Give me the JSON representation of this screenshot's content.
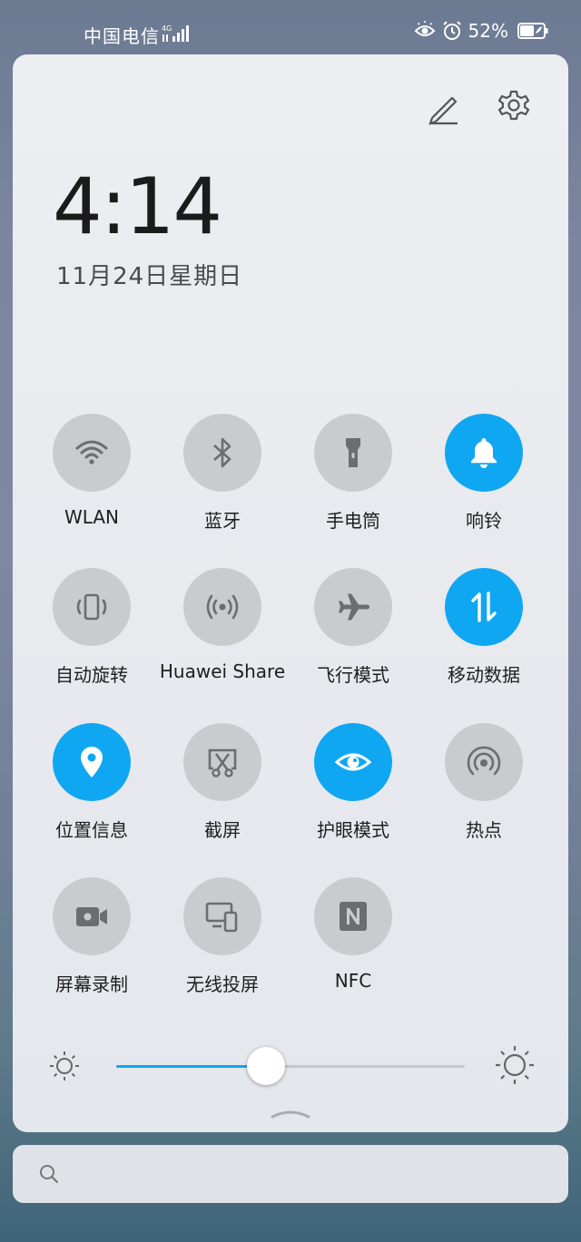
{
  "status_bar": {
    "carrier": "中国电信",
    "network": "4G",
    "battery_percent": "52%"
  },
  "panel": {
    "time": "4:14",
    "date": "11月24日星期日"
  },
  "toggles": [
    {
      "label": "WLAN",
      "icon": "wifi-icon",
      "on": false
    },
    {
      "label": "蓝牙",
      "icon": "bluetooth-icon",
      "on": false
    },
    {
      "label": "手电筒",
      "icon": "flashlight-icon",
      "on": false
    },
    {
      "label": "响铃",
      "icon": "bell-icon",
      "on": true
    },
    {
      "label": "自动旋转",
      "icon": "auto-rotate-icon",
      "on": false
    },
    {
      "label": "Huawei Share",
      "icon": "huawei-share-icon",
      "on": false
    },
    {
      "label": "飞行模式",
      "icon": "airplane-icon",
      "on": false
    },
    {
      "label": "移动数据",
      "icon": "mobile-data-icon",
      "on": true
    },
    {
      "label": "位置信息",
      "icon": "location-icon",
      "on": true
    },
    {
      "label": "截屏",
      "icon": "screenshot-icon",
      "on": false
    },
    {
      "label": "护眼模式",
      "icon": "eye-icon",
      "on": true
    },
    {
      "label": "热点",
      "icon": "hotspot-icon",
      "on": false
    },
    {
      "label": "屏幕录制",
      "icon": "screen-record-icon",
      "on": false
    },
    {
      "label": "无线投屏",
      "icon": "wireless-projection-icon",
      "on": false
    },
    {
      "label": "NFC",
      "icon": "nfc-icon",
      "on": false
    }
  ],
  "brightness": {
    "level": 0.43
  },
  "search": {
    "placeholder": ""
  },
  "colors": {
    "accent": "#10a7f2",
    "off": "#c9cbce"
  }
}
